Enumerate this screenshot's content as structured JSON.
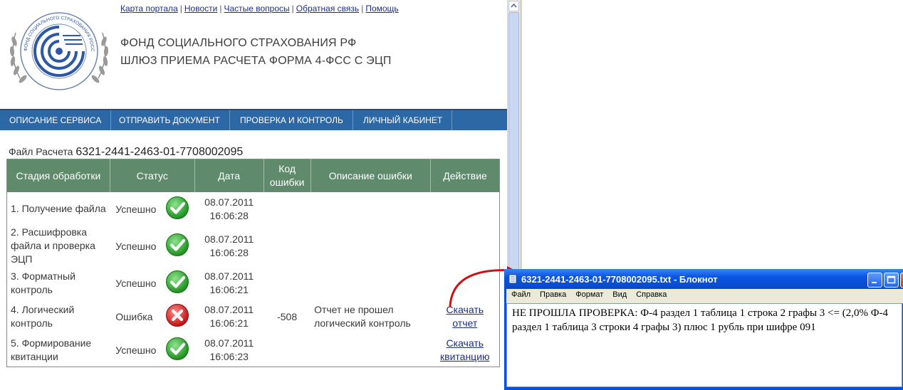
{
  "portal": {
    "links": [
      "Карта портала",
      "Новости",
      "Частые вопросы",
      "Обратная связь",
      "Помощь"
    ],
    "title_line1": "ФОНД СОЦИАЛЬНОГО СТРАХОВАНИЯ РФ",
    "title_line2": "ШЛЮЗ ПРИЕМА РАСЧЕТА ФОРМА 4-ФСС С ЭЦП",
    "logo_text": "ФОНД СОЦИАЛЬНОГО СТРАХОВАНИЯ РОССИЙСКАЯ ФЕДЕРАЦИЯ"
  },
  "nav": [
    "ОПИСАНИЕ СЕРВИСА",
    "ОТПРАВИТЬ ДОКУМЕНТ",
    "ПРОВЕРКА И КОНТРОЛЬ",
    "ЛИЧНЫЙ КАБИНЕТ"
  ],
  "file": {
    "label": "Файл Расчета",
    "name": "6321-2441-2463-01-7708002095"
  },
  "table": {
    "headers": [
      "Стадия обработки",
      "Статус",
      "Дата",
      "Код ошибки",
      "Описание ошибки",
      "Действие"
    ],
    "rows": [
      {
        "stage": "1. Получение файла",
        "status": "Успешно",
        "icon": "check-icon",
        "date": "08.07.2011",
        "time": "16:06:28",
        "code": "",
        "desc": "",
        "action": ""
      },
      {
        "stage": "2. Расшифровка файла и проверка ЭЦП",
        "status": "Успешно",
        "icon": "check-icon",
        "date": "08.07.2011",
        "time": "16:06:28",
        "code": "",
        "desc": "",
        "action": ""
      },
      {
        "stage": "3. Форматный контроль",
        "status": "Успешно",
        "icon": "check-icon",
        "date": "08.07.2011",
        "time": "16:06:21",
        "code": "",
        "desc": "",
        "action": ""
      },
      {
        "stage": "4. Логический контроль",
        "status": "Ошибка",
        "icon": "error-icon",
        "date": "08.07.2011",
        "time": "16:06:21",
        "code": "-508",
        "desc": "Отчет не прошел логический контроль",
        "action": "Скачать отчет"
      },
      {
        "stage": "5. Формирование квитанции",
        "status": "Успешно",
        "icon": "check-icon",
        "date": "08.07.2011",
        "time": "16:06:23",
        "code": "",
        "desc": "",
        "action": "Скачать квитанцию"
      }
    ]
  },
  "notepad": {
    "title": "6321-2441-2463-01-7708002095.txt - Блокнот",
    "menu": [
      "Файл",
      "Правка",
      "Формат",
      "Вид",
      "Справка"
    ],
    "content": "НЕ ПРОШЛА ПРОВЕРКА: Ф-4 раздел 1 таблица 1 строка 2 графы 3 <= (2,0% Ф-4 раздел 1 таблица 3 строки 4 графы 3) плюс 1 рубль при шифре 091"
  },
  "colors": {
    "nav_bg": "#2d68a6",
    "table_header_bg": "#5f8a6c",
    "link": "#1a2f8a",
    "titlebar": "#0a55e4",
    "arrow": "#d01010"
  }
}
